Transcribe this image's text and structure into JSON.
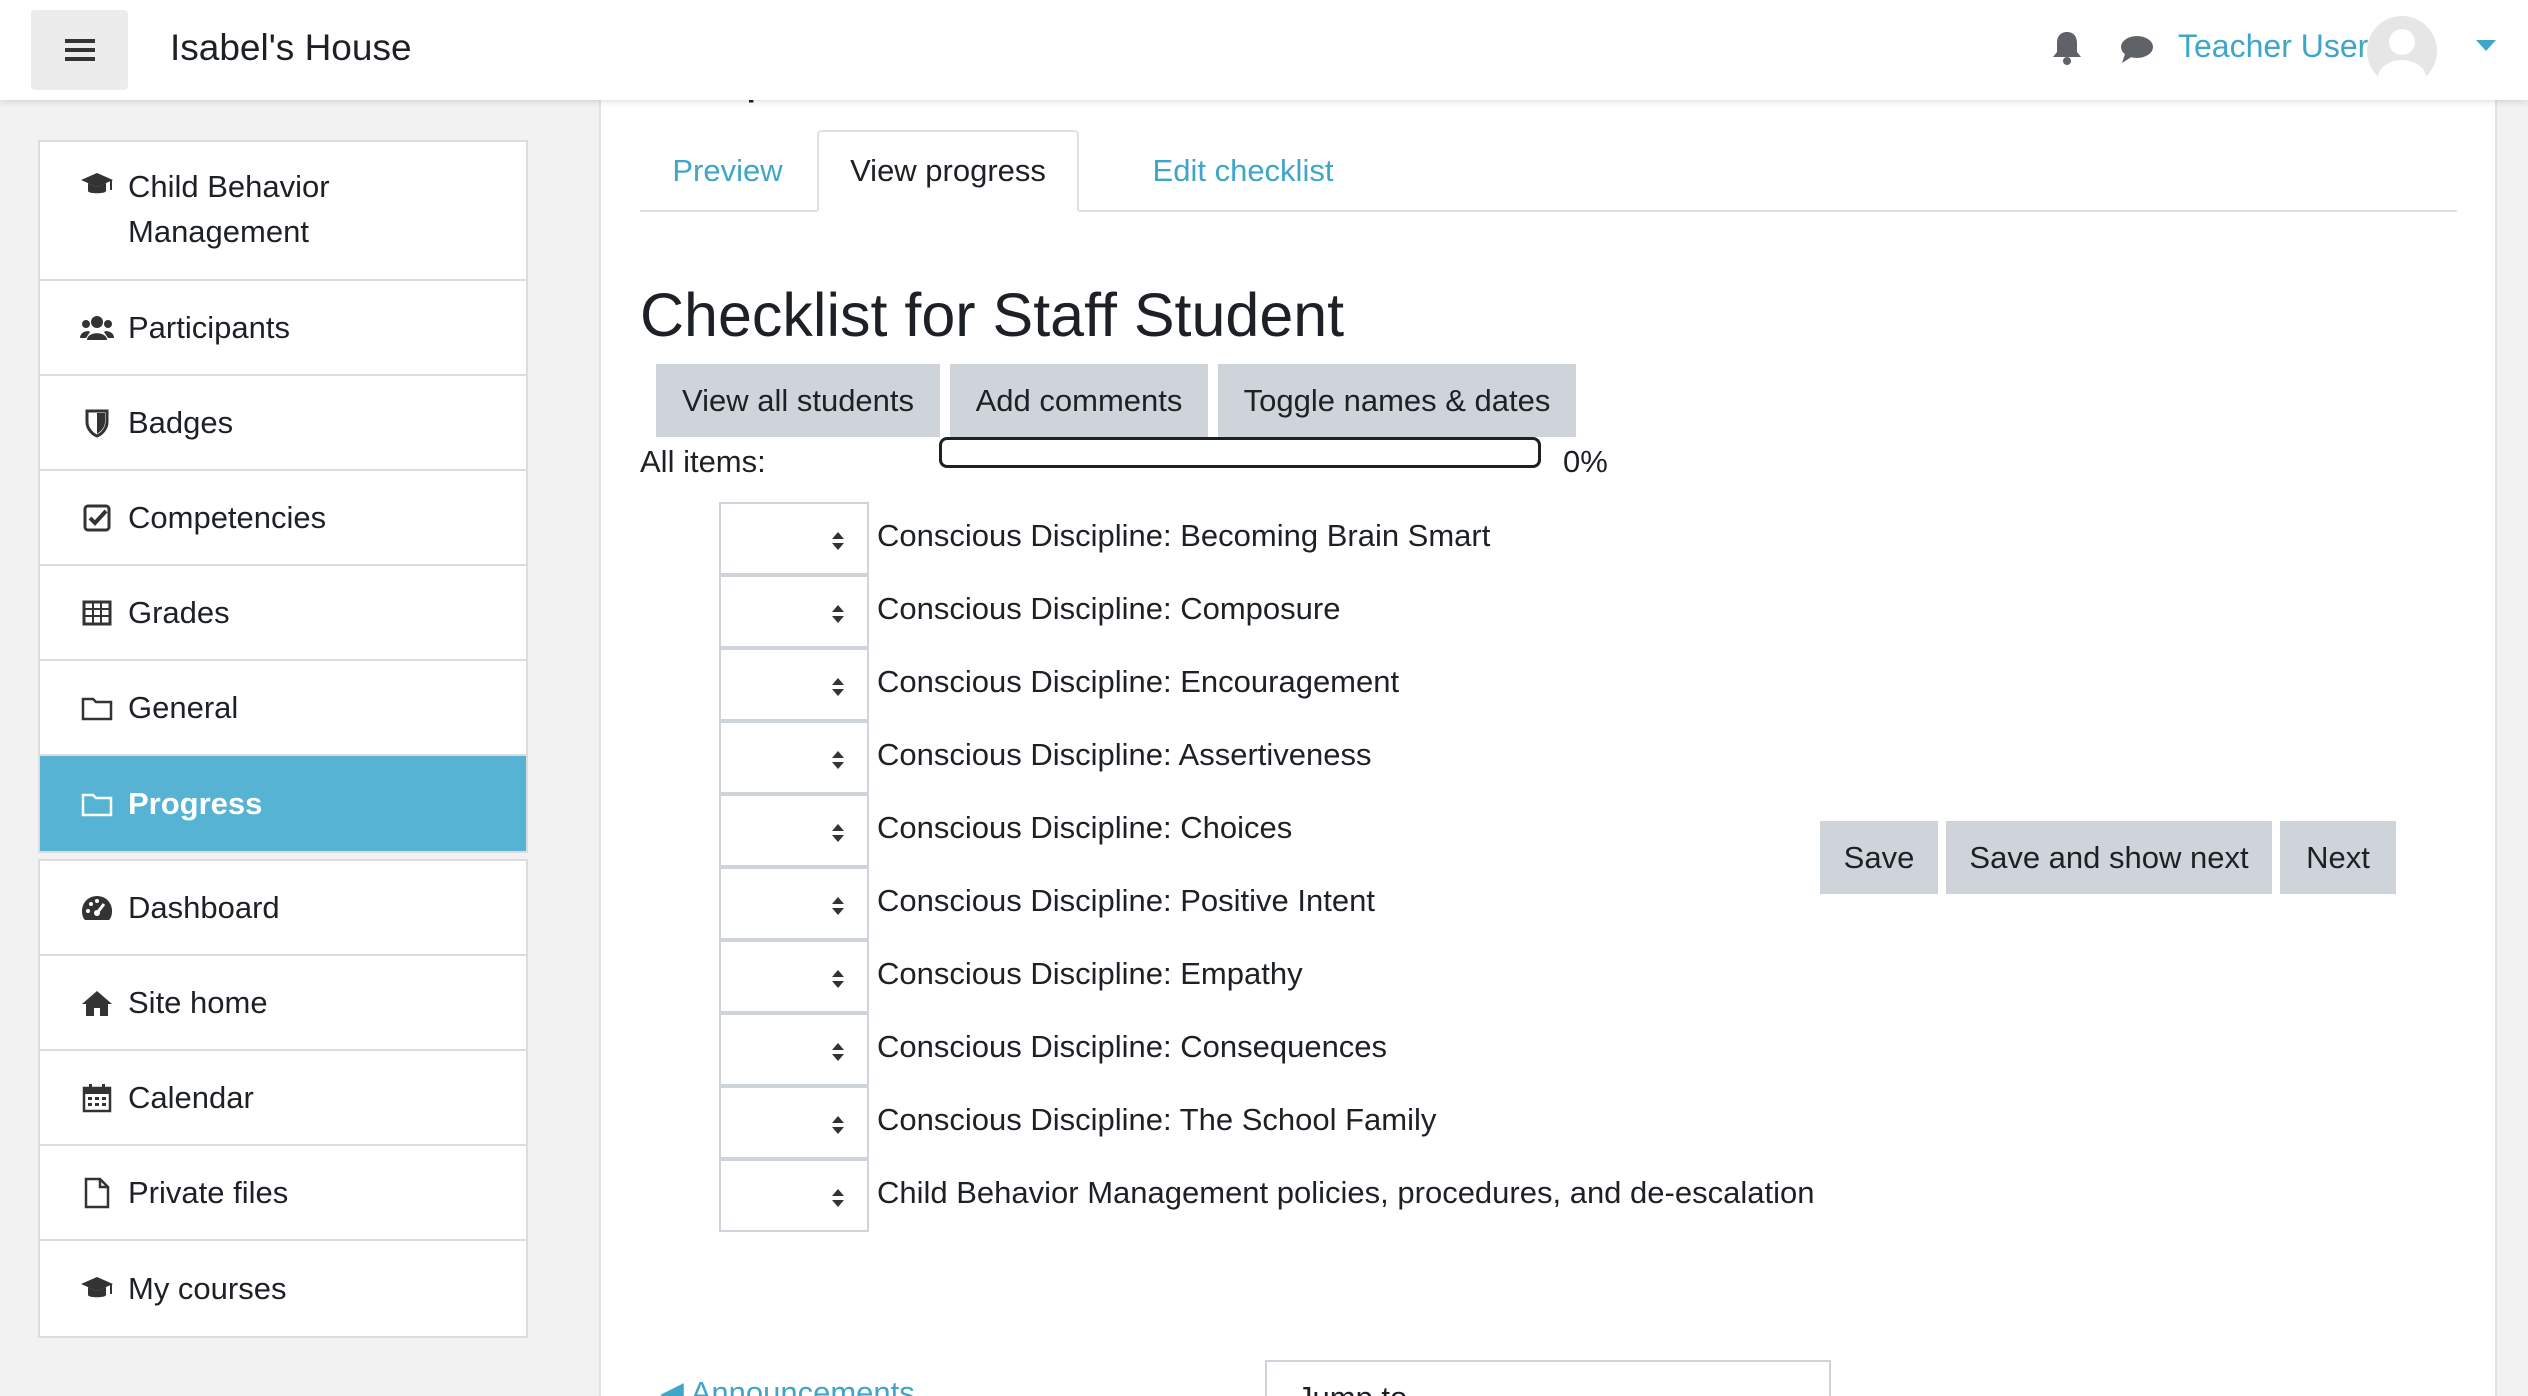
{
  "header": {
    "site_title": "Isabel's House",
    "user_name": "Teacher User"
  },
  "sidebar": {
    "course_items": [
      {
        "label": "Child Behavior Management",
        "icon": "graduation-cap-icon"
      },
      {
        "label": "Participants",
        "icon": "users-icon"
      },
      {
        "label": "Badges",
        "icon": "shield-icon"
      },
      {
        "label": "Competencies",
        "icon": "check-square-icon"
      },
      {
        "label": "Grades",
        "icon": "table-icon"
      },
      {
        "label": "General",
        "icon": "folder-icon"
      },
      {
        "label": "Progress",
        "icon": "folder-icon",
        "active": true
      }
    ],
    "site_items": [
      {
        "label": "Dashboard",
        "icon": "dashboard-icon"
      },
      {
        "label": "Site home",
        "icon": "home-icon"
      },
      {
        "label": "Calendar",
        "icon": "calendar-icon"
      },
      {
        "label": "Private files",
        "icon": "file-icon"
      },
      {
        "label": "My courses",
        "icon": "graduation-cap-icon"
      }
    ]
  },
  "main": {
    "cut_heading": "Completion",
    "tabs": [
      {
        "label": "Preview",
        "active": false
      },
      {
        "label": "View progress",
        "active": true
      },
      {
        "label": "Edit checklist",
        "active": false
      }
    ],
    "heading": "Checklist for Staff Student",
    "buttons": {
      "view_all": "View all students",
      "add_comments": "Add comments",
      "toggle": "Toggle names & dates",
      "save": "Save",
      "save_next": "Save and show next",
      "next": "Next"
    },
    "all_items_label": "All items:",
    "progress_percent": 0,
    "progress_text": "0%",
    "items": [
      "Conscious Discipline: Becoming Brain Smart",
      "Conscious Discipline: Composure",
      "Conscious Discipline: Encouragement",
      "Conscious Discipline: Assertiveness",
      "Conscious Discipline: Choices",
      "Conscious Discipline: Positive Intent",
      "Conscious Discipline: Empathy",
      "Conscious Discipline: Consequences",
      "Conscious Discipline: The School Family",
      "Child Behavior Management policies, procedures, and de-escalation"
    ],
    "prev_link": "◀ Announcements",
    "jump_to": "Jump to..."
  },
  "colors": {
    "accent": "#40a6c7",
    "active_nav": "#56b3d3",
    "button": "#ced4da"
  }
}
